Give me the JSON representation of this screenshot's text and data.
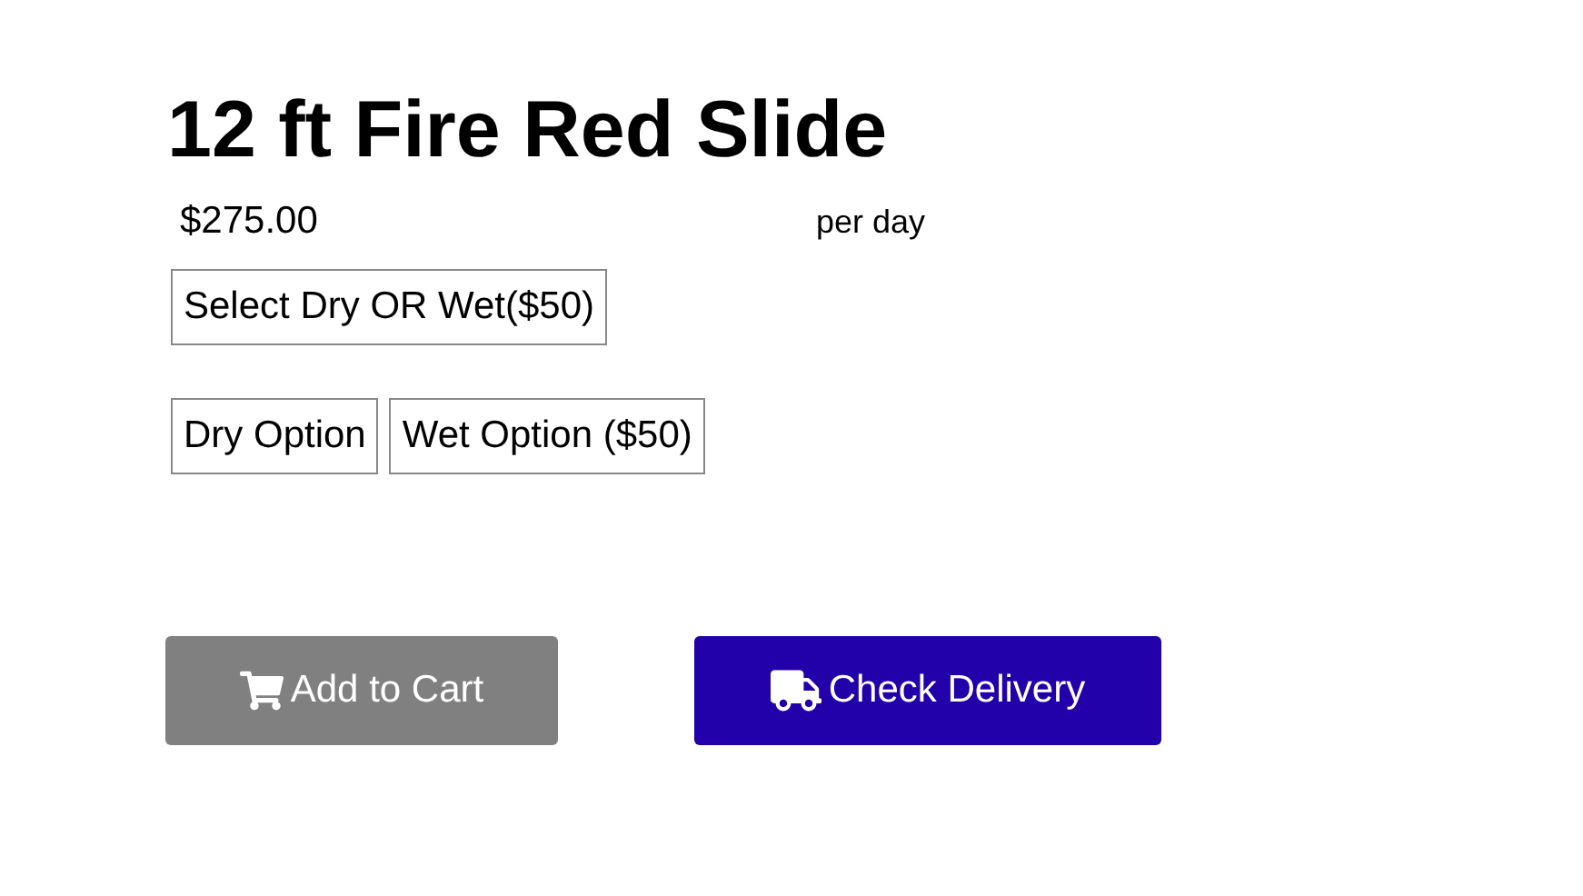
{
  "product": {
    "title": "12 ft Fire Red Slide",
    "price": "$275.00",
    "unit": "per day"
  },
  "option_group": {
    "label": "Select Dry OR Wet($50)",
    "options": [
      {
        "label": "Dry Option"
      },
      {
        "label": "Wet Option ($50)"
      }
    ]
  },
  "buttons": [
    {
      "kind": "cart",
      "label": "Add to Cart",
      "disabled": true
    },
    {
      "kind": "delivery",
      "label": "Check Delivery",
      "disabled": false
    }
  ]
}
